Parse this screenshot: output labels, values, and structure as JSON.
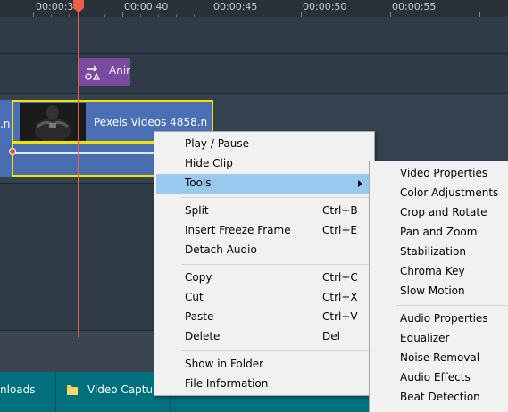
{
  "ruler": {
    "labels": [
      "00:00:3",
      "00:00:40",
      "00:00:45",
      "00:00:50",
      "00:00:55"
    ]
  },
  "timeline": {
    "animation_label": "Anim",
    "clip_left_text": ".n",
    "clip_name": "Pexels Videos 4858.n"
  },
  "context_menu": {
    "play_pause": "Play / Pause",
    "hide_clip": "Hide Clip",
    "tools": "Tools",
    "split": "Split",
    "split_sc": "Ctrl+B",
    "freeze": "Insert Freeze Frame",
    "freeze_sc": "Ctrl+E",
    "detach": "Detach Audio",
    "copy": "Copy",
    "copy_sc": "Ctrl+C",
    "cut": "Cut",
    "cut_sc": "Ctrl+X",
    "paste": "Paste",
    "paste_sc": "Ctrl+V",
    "delete": "Delete",
    "delete_sc": "Del",
    "show_folder": "Show in Folder",
    "file_info": "File Information"
  },
  "tools_submenu": {
    "video_properties": "Video Properties",
    "color_adjustments": "Color Adjustments",
    "crop_rotate": "Crop and Rotate",
    "pan_zoom": "Pan and Zoom",
    "stabilization": "Stabilization",
    "chroma_key": "Chroma Key",
    "slow_motion": "Slow Motion",
    "audio_properties": "Audio Properties",
    "equalizer": "Equalizer",
    "noise_removal": "Noise Removal",
    "audio_effects": "Audio Effects",
    "beat_detection": "Beat Detection"
  },
  "taskbar": {
    "item_downloads": "nloads",
    "item_video_capture": "Video Capture"
  },
  "colors": {
    "highlight": "#99c9ef",
    "clip": "#4b6fb4",
    "selection_border": "#f5e100",
    "playhead": "#e8604c",
    "animation_block": "#7a4a9e",
    "taskbar": "#00707c"
  }
}
